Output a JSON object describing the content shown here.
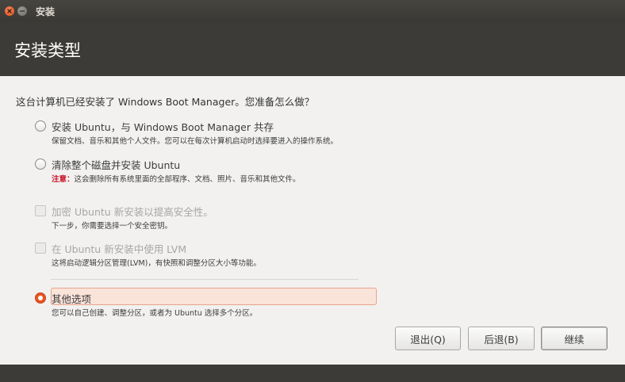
{
  "window": {
    "title": "安装",
    "close_icon": "close-icon",
    "minimize_icon": "minimize-icon"
  },
  "header": {
    "title": "安装类型"
  },
  "main": {
    "question": "这台计算机已经安装了 Windows Boot Manager。您准备怎么做？",
    "options": [
      {
        "label": "安装 Ubuntu，与 Windows Boot Manager 共存",
        "description": "保留文档、音乐和其他个人文件。您可以在每次计算机启动时选择要进入的操作系统。",
        "type": "radio",
        "checked": false,
        "enabled": true
      },
      {
        "label": "清除整个磁盘并安装 Ubuntu",
        "warning_prefix": "注意：",
        "description": "这会删除所有系统里面的全部程序、文档、照片、音乐和其他文件。",
        "type": "radio",
        "checked": false,
        "enabled": true
      },
      {
        "label": "加密 Ubuntu 新安装以提高安全性。",
        "description": "下一步，你需要选择一个安全密钥。",
        "type": "checkbox",
        "checked": false,
        "enabled": false
      },
      {
        "label": "在 Ubuntu 新安装中使用 LVM",
        "description": "这将启动逻辑分区管理(LVM)，有快照和调整分区大小等功能。",
        "type": "checkbox",
        "checked": false,
        "enabled": false
      },
      {
        "label": "其他选项",
        "description": "您可以自己创建、调整分区，或者为 Ubuntu 选择多个分区。",
        "type": "radio",
        "checked": true,
        "enabled": true
      }
    ]
  },
  "buttons": {
    "quit": "退出(Q)",
    "back": "后退(B)",
    "continue": "继续"
  },
  "colors": {
    "accent": "#e95420",
    "warning": "#c7162b",
    "header_bg": "#3c3b37",
    "content_bg": "#f2f1f0"
  }
}
